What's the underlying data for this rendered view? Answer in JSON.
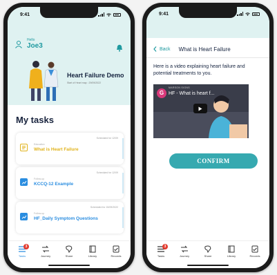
{
  "status_bar": {
    "time": "9:41"
  },
  "dashboard": {
    "hello_label": "Hello",
    "user_name": "Joe3",
    "program_title": "Heart Failure Demo",
    "program_subtitle": "Start of Heart map : 29/09/2022",
    "tasks_heading": "My tasks",
    "tasks": [
      {
        "kind": "Education",
        "name": "What is Heart Failure",
        "date": "Scheduled for 12/09",
        "color": "#e0b21a",
        "icon": "document-icon"
      },
      {
        "kind": "Follow-up",
        "name": "KCCQ-12 Example",
        "date": "Scheduled for 12/09",
        "color": "#2a8de0",
        "icon": "chart-icon"
      },
      {
        "kind": "Follow-up",
        "name": "HF_Daily Symptom Questions",
        "date": "Scheduled for 15/09/2022",
        "color": "#2a8de0",
        "icon": "chart-icon"
      }
    ]
  },
  "tabbar": {
    "badge": "3",
    "tabs": [
      {
        "label": "Tasks",
        "icon": "tasks-icon"
      },
      {
        "label": "Journey",
        "icon": "journey-icon"
      },
      {
        "label": "Share",
        "icon": "share-icon"
      },
      {
        "label": "Library",
        "icon": "library-icon"
      },
      {
        "label": "Records",
        "icon": "records-icon"
      }
    ]
  },
  "detail": {
    "back_label": "Back",
    "title": "What is Heart Failure",
    "intro": "Here is a video explaining heart failure and potential treatments to you.",
    "video": {
      "channel_initial": "G",
      "channel_name": "MARSON SIGNS",
      "title": "HF - What is heart f..."
    },
    "confirm_label": "CONFIRM"
  },
  "colors": {
    "accent": "#1f9aa0",
    "confirm": "#36a9b0",
    "education": "#e0b21a",
    "followup": "#2a8de0",
    "badge": "#e23b2e"
  }
}
